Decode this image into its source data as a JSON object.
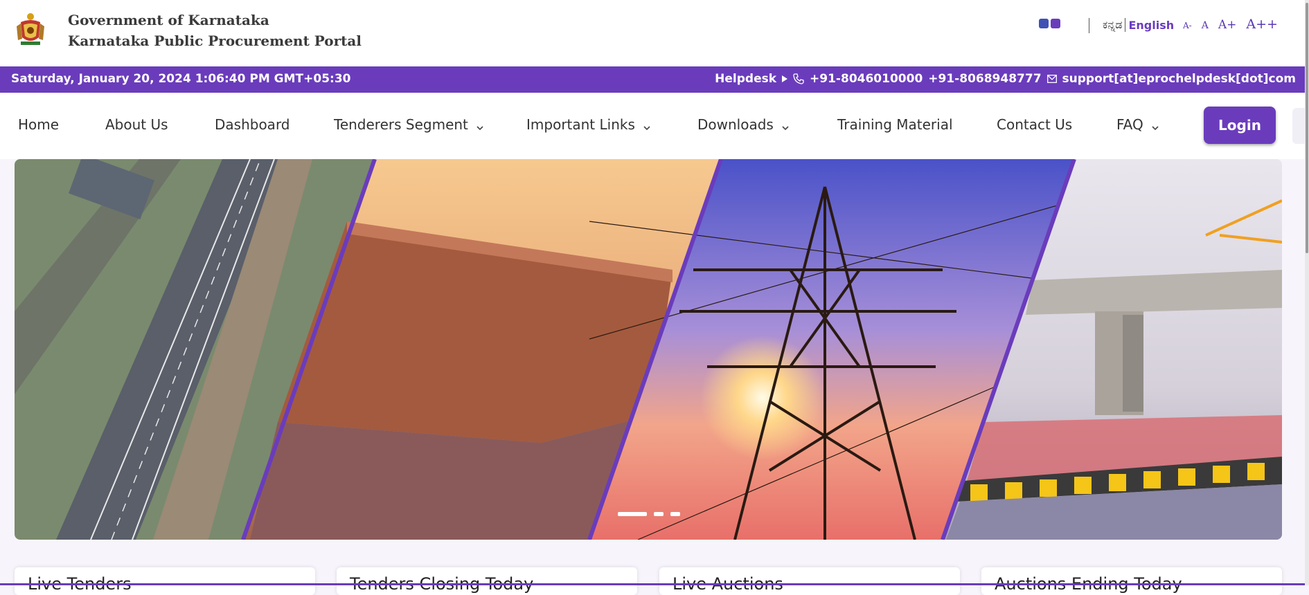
{
  "header": {
    "title_line1": "Government of Karnataka",
    "title_line2": "Karnataka Public Procurement Portal",
    "theme_colors": [
      "#3f51b5",
      "#6a3cbc"
    ],
    "languages": {
      "kannada": "ಕನ್ನಡ",
      "english": "English"
    },
    "font_sizes": [
      "A-",
      "A",
      "A+",
      "A++"
    ]
  },
  "infobar": {
    "datetime": "Saturday, January 20, 2024 1:06:40 PM GMT+05:30",
    "helpdesk_label": "Helpdesk",
    "phone1": "+91-8046010000",
    "phone2": "+91-8068948777",
    "email": "support[at]eprochelpdesk[dot]com",
    "color": "#6a3cbc"
  },
  "nav": {
    "items": [
      {
        "label": "Home",
        "dropdown": false
      },
      {
        "label": "About Us",
        "dropdown": false
      },
      {
        "label": "Dashboard",
        "dropdown": false
      },
      {
        "label": "Tenderers Segment",
        "dropdown": true
      },
      {
        "label": "Important Links",
        "dropdown": true
      },
      {
        "label": "Downloads",
        "dropdown": true
      },
      {
        "label": "Training Material",
        "dropdown": false
      },
      {
        "label": "Contact Us",
        "dropdown": false
      },
      {
        "label": "FAQ",
        "dropdown": true
      }
    ],
    "login_label": "Login"
  },
  "carousel": {
    "slides": [
      "highway-image",
      "dam-image",
      "power-tower-image",
      "metro-construction-image"
    ],
    "active_slide": 0,
    "slide_count": 3
  },
  "cards": [
    {
      "title": "Live Tenders"
    },
    {
      "title": "Tenders Closing Today"
    },
    {
      "title": "Live Auctions"
    },
    {
      "title": "Auctions Ending Today"
    }
  ]
}
